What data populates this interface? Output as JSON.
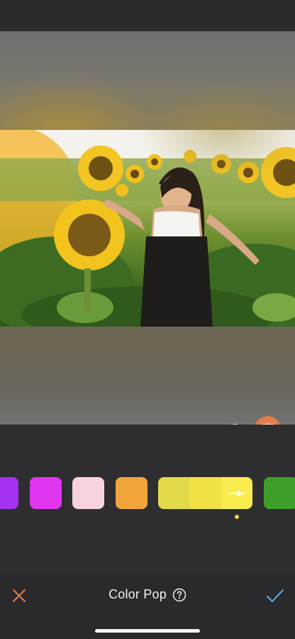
{
  "editor": {
    "title": "Color Pop",
    "slider_value": 0.97
  },
  "colors": {
    "accent_orange": "#e37d4a",
    "confirm_blue": "#5ab3e6"
  },
  "icons": {
    "close": "close-icon",
    "confirm": "checkmark-icon",
    "help": "help-circle-icon",
    "compare": "compare-icon",
    "adjust": "slider-handle-icon"
  },
  "swatches": [
    {
      "name": "purple",
      "color": "#a532f0"
    },
    {
      "name": "magenta",
      "color": "#e036f0"
    },
    {
      "name": "pink",
      "color": "#f6d3dd"
    },
    {
      "name": "orange",
      "color": "#f0a43a"
    },
    {
      "name": "yellow",
      "color": "#ebe24a",
      "selected": true,
      "shades": [
        "#e3da4a",
        "#f0e246",
        "#f8ec4e"
      ]
    },
    {
      "name": "green",
      "color": "#3ea02a"
    }
  ]
}
